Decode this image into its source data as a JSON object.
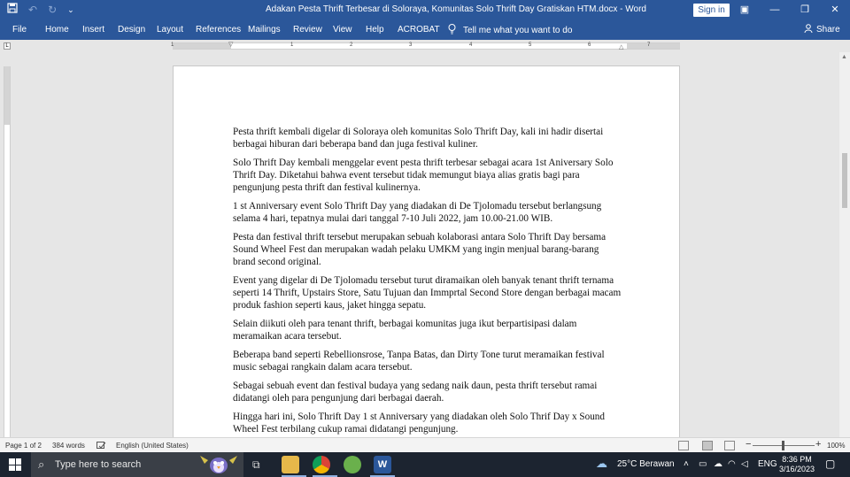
{
  "window": {
    "title": "Adakan Pesta Thrift Terbesar di Soloraya, Komunitas Solo Thrift Day Gratiskan HTM.docx  -  Word",
    "signin_label": "Sign in",
    "qat": {
      "save_icon": "save-icon",
      "undo_icon": "undo-icon",
      "redo_icon": "redo-icon",
      "customize_icon": "customize-icon"
    },
    "controls": {
      "ribbon_display": "ribbon-display-icon",
      "minimize": "minimize-icon",
      "restore": "restore-icon",
      "close": "close-icon"
    }
  },
  "menu": {
    "tabs": [
      "File",
      "Home",
      "Insert",
      "Design",
      "Layout",
      "References",
      "Mailings",
      "Review",
      "View",
      "Help",
      "ACROBAT"
    ],
    "tell_me": "Tell me what you want to do",
    "share": "Share"
  },
  "ruler": {
    "ticks": [
      "1",
      "1",
      "2",
      "3",
      "4",
      "5",
      "6",
      "7"
    ]
  },
  "document": {
    "paragraphs": [
      "Pesta thrift kembali digelar di Soloraya oleh komunitas Solo Thrift Day, kali ini hadir disertai berbagai hiburan dari beberapa band dan juga festival kuliner.",
      "Solo Thrift Day kembali menggelar event pesta thrift terbesar sebagai acara 1st Aniversary Solo Thrift Day. Diketahui bahwa event tersebut tidak memungut biaya alias gratis bagi para pengunjung pesta thrift dan festival kulinernya.",
      "1 st Anniversary event Solo Thrift Day yang diadakan di De Tjolomadu tersebut berlangsung selama 4 hari, tepatnya mulai dari tanggal 7-10 Juli 2022, jam 10.00-21.00 WIB.",
      "Pesta dan festival thrift tersebut merupakan sebuah kolaborasi antara Solo Thrift Day bersama Sound Wheel Fest dan merupakan wadah pelaku UMKM yang ingin menjual barang-barang brand second original.",
      "Event yang digelar di De Tjolomadu tersebut turut diramaikan oleh banyak tenant thrift ternama  seperti 14 Thrift, Upstairs Store, Satu Tujuan dan Immprtal Second Store dengan berbagai macam produk fashion seperti kaus, jaket hingga sepatu.",
      "Selain diikuti oleh para tenant thrift, berbagai komunitas  juga ikut berpartisipasi dalam meramaikan acara tersebut.",
      "Beberapa band seperti Rebellionsrose, Tanpa Batas, dan Dirty Tone turut meramaikan festival music sebagai rangkain dalam acara tersebut.",
      "Sebagai sebuah event dan festival budaya yang sedang naik daun, pesta thrift tersebut ramai didatangi oleh para pengunjung dari berbagai daerah.",
      "Hingga hari ini, Solo Thrift Day 1 st Anniversary yang diadakan oleh Solo Thrif Day x Sound Wheel Fest terbilang cukup ramai didatangi pengunjung."
    ]
  },
  "status": {
    "page": "Page 1 of 2",
    "words": "384 words",
    "language": "English (United States)",
    "zoom": "100%",
    "zoom_minus": "−",
    "zoom_plus": "+"
  },
  "taskbar": {
    "search_placeholder": "Type here to search",
    "weather": "25°C  Berawan",
    "lang": "ENG",
    "time": "8:36 PM",
    "date": "3/16/2023"
  },
  "colors": {
    "word_blue": "#2b579a",
    "taskbar": "#1c2430"
  }
}
